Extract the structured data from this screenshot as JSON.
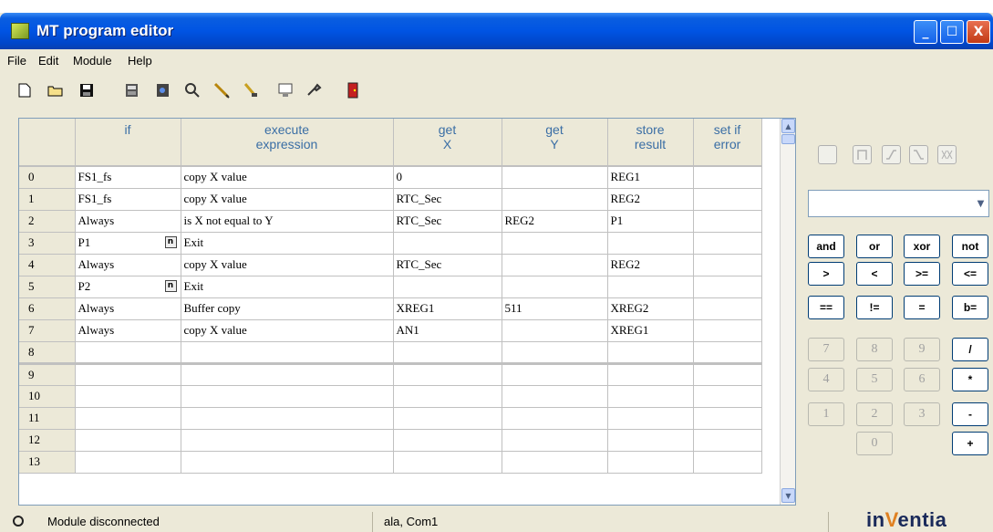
{
  "window": {
    "title": "MT program editor",
    "min_glyph": "_",
    "max_glyph": "☐",
    "close_glyph": "X"
  },
  "menu": [
    "File",
    "Edit",
    "Module",
    "Help"
  ],
  "toolbar": [
    "new-file-icon",
    "open-folder-icon",
    "save-disk-icon",
    "compile-icon",
    "program-icon",
    "search-icon",
    "edit-pencil-icon",
    "clear-icon",
    "monitor-icon",
    "tools-icon",
    "exit-door-icon"
  ],
  "table": {
    "headers": [
      {
        "line1": "if",
        "line2": ""
      },
      {
        "line1": "execute",
        "line2": "expression"
      },
      {
        "line1": "get",
        "line2": "X"
      },
      {
        "line1": "get",
        "line2": "Y"
      },
      {
        "line1": "store",
        "line2": "result"
      },
      {
        "line1": "set if",
        "line2": "error"
      }
    ],
    "rows": [
      {
        "num": "0",
        "if": "FS1_fs",
        "exec": "copy X value",
        "x": "0",
        "y": "",
        "store": "REG1",
        "err": "",
        "exit": false
      },
      {
        "num": "1",
        "if": "FS1_fs",
        "exec": "copy X value",
        "x": "RTC_Sec",
        "y": "",
        "store": "REG2",
        "err": "",
        "exit": false
      },
      {
        "num": "2",
        "if": "Always",
        "exec": "is X not equal to Y",
        "x": "RTC_Sec",
        "y": "REG2",
        "store": "P1",
        "err": "",
        "exit": false
      },
      {
        "num": "3",
        "if": "P1",
        "exec": "Exit",
        "x": "",
        "y": "",
        "store": "",
        "err": "",
        "exit": true
      },
      {
        "num": "4",
        "if": "Always",
        "exec": "copy X value",
        "x": "RTC_Sec",
        "y": "",
        "store": "REG2",
        "err": "",
        "exit": false
      },
      {
        "num": "5",
        "if": "P2",
        "exec": "Exit",
        "x": "",
        "y": "",
        "store": "",
        "err": "",
        "exit": true
      },
      {
        "num": "6",
        "if": "Always",
        "exec": "Buffer copy",
        "x": "XREG1",
        "y": "511",
        "store": "XREG2",
        "err": "",
        "exit": false
      },
      {
        "num": "7",
        "if": "Always",
        "exec": "copy X value",
        "x": "AN1",
        "y": "",
        "store": "XREG1",
        "err": "",
        "exit": false
      },
      {
        "num": "8",
        "if": "",
        "exec": "",
        "x": "",
        "y": "",
        "store": "",
        "err": "",
        "exit": false
      },
      {
        "num": "9",
        "if": "",
        "exec": "",
        "x": "",
        "y": "",
        "store": "",
        "err": "",
        "exit": false
      },
      {
        "num": "10",
        "if": "",
        "exec": "",
        "x": "",
        "y": "",
        "store": "",
        "err": "",
        "exit": false
      },
      {
        "num": "11",
        "if": "",
        "exec": "",
        "x": "",
        "y": "",
        "store": "",
        "err": "",
        "exit": false
      },
      {
        "num": "12",
        "if": "",
        "exec": "",
        "x": "",
        "y": "",
        "store": "",
        "err": "",
        "exit": false
      },
      {
        "num": "13",
        "if": "",
        "exec": "",
        "x": "",
        "y": "",
        "store": "",
        "err": "",
        "exit": false
      }
    ],
    "exit_marker": "n",
    "separator_after_row": "8"
  },
  "side_icons": [
    "blank-icon",
    "pulse-n-icon",
    "rising-edge-icon",
    "falling-edge-icon",
    "both-edges-icon"
  ],
  "combo": {
    "value": ""
  },
  "operators": [
    "and",
    "or",
    "xor",
    "not",
    ">",
    "<",
    ">=",
    "<=",
    "==",
    "!=",
    "=",
    "b="
  ],
  "digits": [
    "7",
    "8",
    "9",
    "4",
    "5",
    "6",
    "1",
    "2",
    "3",
    "0"
  ],
  "arith": [
    "/",
    "*",
    "-",
    "+"
  ],
  "status": {
    "connection": "Module disconnected",
    "port": "ala, Com1"
  },
  "logo": {
    "pre": "in",
    "accent": "V",
    "post": "entia"
  }
}
